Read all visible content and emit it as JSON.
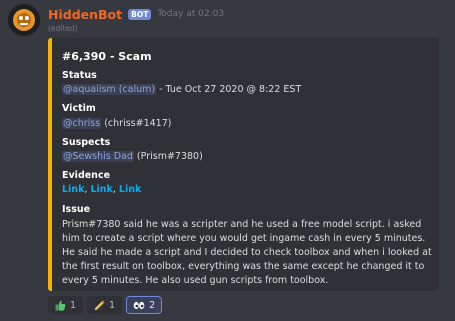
{
  "message": {
    "username": "HiddenBot",
    "bot_tag": "BOT",
    "timestamp": "Today at 02:03",
    "edited": "(edited)",
    "avatar_icon": "bot-avatar-icon"
  },
  "embed": {
    "accent_color": "#f4b400",
    "title": "#6,390 - Scam",
    "status": {
      "name": "Status",
      "mention": "@aquaiism (calum)",
      "text": " - Tue Oct 27 2020 @ 8:22 EST"
    },
    "victim": {
      "name": "Victim",
      "mention": "@chriss",
      "text": " (chriss#1417)"
    },
    "suspects": {
      "name": "Suspects",
      "mention": "@Sewshis Dad",
      "text": " (Prism#7380)"
    },
    "evidence": {
      "name": "Evidence",
      "links": [
        "Link",
        "Link",
        "Link"
      ]
    },
    "issue": {
      "name": "Issue",
      "text": "Prism#7380 said he was a scripter and he used a free model script. i asked him to create a script where you would get ingame cash in every 5 minutes. He said he made a script and I decided to check toolbox and when i looked at the first result on toolbox, everything was the same except he changed it to every 5 minutes. He also used gun scripts from toolbox."
    }
  },
  "reactions": [
    {
      "icon": "thumbs-up-icon",
      "count": "1",
      "active": false
    },
    {
      "icon": "pencil-icon",
      "count": "1",
      "active": false
    },
    {
      "icon": "eyes-icon",
      "count": "2",
      "active": true
    }
  ]
}
